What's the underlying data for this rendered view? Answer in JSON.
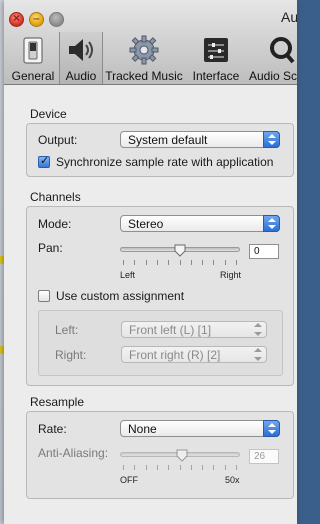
{
  "window": {
    "title": "Au"
  },
  "toolbar": {
    "items": [
      {
        "label": "General",
        "icon": "switch-icon"
      },
      {
        "label": "Audio",
        "icon": "speaker-icon",
        "selected": true
      },
      {
        "label": "Tracked Music",
        "icon": "gear-icon"
      },
      {
        "label": "Interface",
        "icon": "sliders-panel-icon"
      },
      {
        "label": "Audio Scr",
        "icon": "search-icon"
      }
    ]
  },
  "device": {
    "section_title": "Device",
    "output_label": "Output:",
    "output_value": "System default",
    "sync_label": "Synchronize sample rate with application",
    "sync_checked": true
  },
  "channels": {
    "section_title": "Channels",
    "mode_label": "Mode:",
    "mode_value": "Stereo",
    "pan_label": "Pan:",
    "pan_value": "0",
    "pan_position_fraction": 0.5,
    "pan_min_label": "Left",
    "pan_max_label": "Right",
    "custom_label": "Use custom assignment",
    "custom_checked": false,
    "left_label": "Left:",
    "left_value": "Front left (L) [1]",
    "right_label": "Right:",
    "right_value": "Front right (R) [2]"
  },
  "resample": {
    "section_title": "Resample",
    "rate_label": "Rate:",
    "rate_value": "None",
    "aa_label": "Anti-Aliasing:",
    "aa_value": "26",
    "aa_position_fraction": 0.52,
    "aa_min_label": "OFF",
    "aa_max_label": "50x"
  },
  "colors": {
    "accent": "#3478db",
    "window_bg": "#ececec"
  }
}
